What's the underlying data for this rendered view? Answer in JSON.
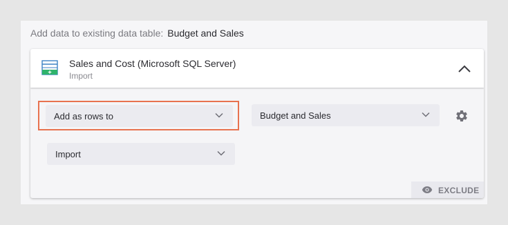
{
  "header": {
    "prefix": "Add data to existing data table:",
    "table_name": "Budget and Sales"
  },
  "source": {
    "title": "Sales and Cost (Microsoft SQL Server)",
    "subtitle": "Import",
    "icon": "table-add-icon"
  },
  "options": {
    "operation": {
      "value": "Add as rows to",
      "icon": "chevron-down-icon"
    },
    "target_table": {
      "value": "Budget and Sales",
      "icon": "chevron-down-icon"
    },
    "source_mode": {
      "value": "Import",
      "icon": "chevron-down-icon"
    },
    "settings_icon": "gear-icon",
    "collapse_icon": "chevron-up-icon"
  },
  "exclude": {
    "label": "EXCLUDE",
    "icon": "eye-icon"
  },
  "colors": {
    "highlight": "#e8724f",
    "icon_blue": "#3b82c4",
    "icon_green": "#2fb36b"
  }
}
